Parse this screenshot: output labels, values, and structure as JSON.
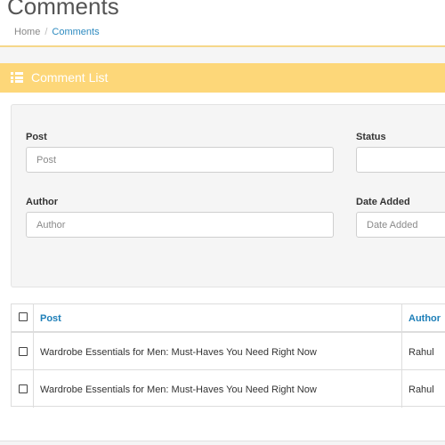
{
  "page": {
    "title": "Comments",
    "breadcrumb": {
      "home": "Home",
      "current": "Comments"
    }
  },
  "panel": {
    "title": "Comment List",
    "icon": "list-icon"
  },
  "filters": {
    "post": {
      "label": "Post",
      "placeholder": "Post",
      "value": ""
    },
    "status": {
      "label": "Status",
      "value": ""
    },
    "author": {
      "label": "Author",
      "placeholder": "Author",
      "value": ""
    },
    "date_added": {
      "label": "Date Added",
      "placeholder": "Date Added",
      "value": ""
    }
  },
  "table": {
    "columns": [
      "Post",
      "Author"
    ],
    "rows": [
      {
        "post": "Wardrobe Essentials for Men: Must-Haves You Need Right Now",
        "author": "Rahul"
      },
      {
        "post": "Wardrobe Essentials for Men: Must-Haves You Need Right Now",
        "author": "Rahul"
      }
    ]
  },
  "colors": {
    "accent": "#fdd779",
    "link": "#1e7fb8"
  }
}
